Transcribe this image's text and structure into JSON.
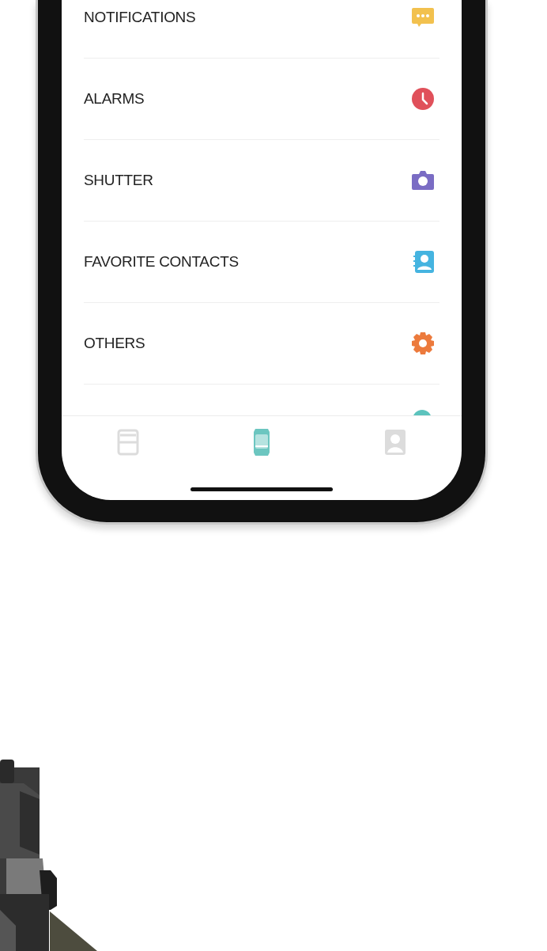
{
  "settings_list": [
    {
      "label": "NOTIFICATIONS",
      "color": "#f2c14e"
    },
    {
      "label": "ALARMS",
      "color": "#e0505a"
    },
    {
      "label": "SHUTTER",
      "color": "#7a6cc4"
    },
    {
      "label": "FAVORITE CONTACTS",
      "color": "#45b4e0"
    },
    {
      "label": "OTHERS",
      "color": "#ec7a3c"
    },
    {
      "color": "#5cc3bd"
    }
  ],
  "tab_bar": [
    {
      "selected": false
    },
    {
      "selected": true
    },
    {
      "selected": false
    }
  ]
}
